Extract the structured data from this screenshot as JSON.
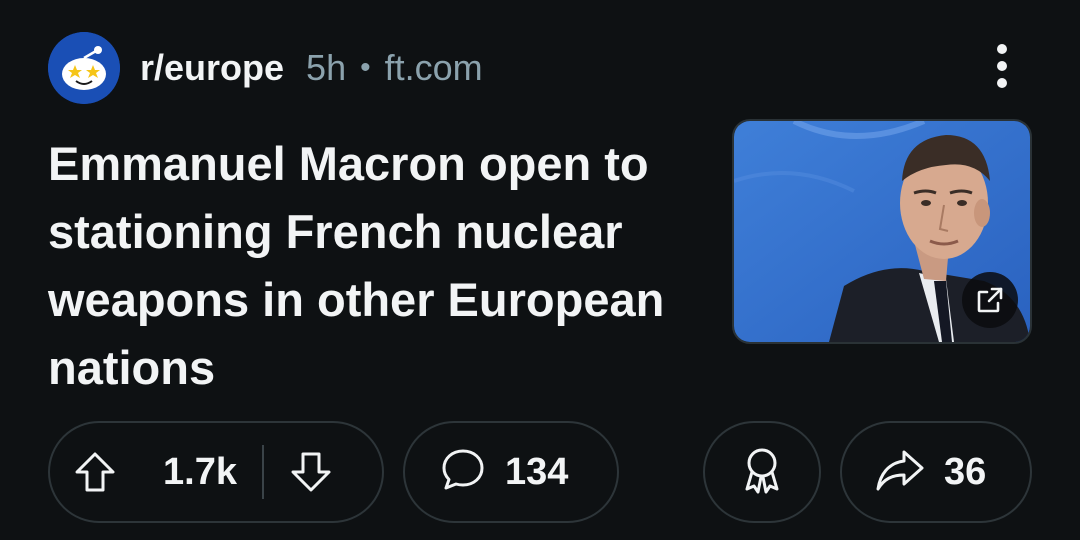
{
  "header": {
    "subreddit": "r/europe",
    "age": "5h",
    "separator": "•",
    "domain": "ft.com"
  },
  "post": {
    "title": "Emmanuel Macron open to stationing French nuclear weapons in other European nations"
  },
  "actions": {
    "upvotes": "1.7k",
    "comments": "134",
    "shares": "36"
  },
  "colors": {
    "background": "#0e1113",
    "text": "#f2f4f5",
    "meta": "#8ba2ad",
    "pill_border": "#2d3539",
    "avatar_bg": "#1a4fb5"
  },
  "icons": [
    "subreddit-avatar",
    "overflow-menu-icon",
    "external-link-icon",
    "upvote-icon",
    "downvote-icon",
    "comment-icon",
    "award-icon",
    "share-icon"
  ]
}
